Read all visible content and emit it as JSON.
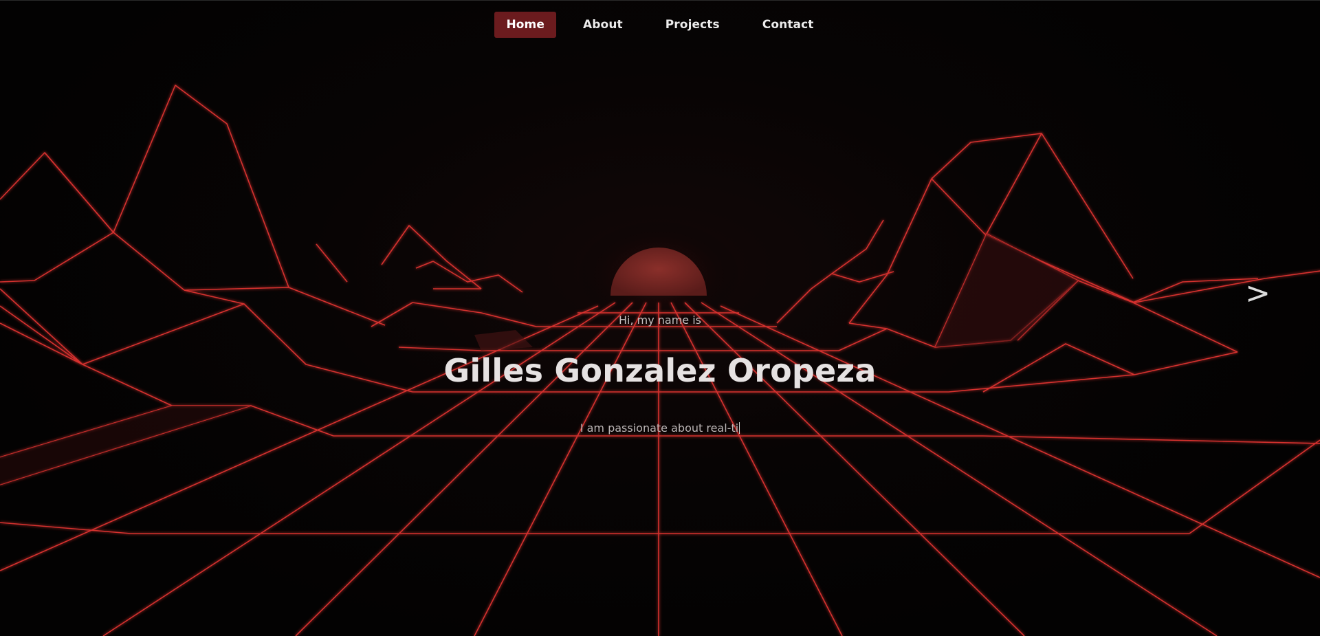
{
  "nav": {
    "items": [
      {
        "label": "Home",
        "active": true
      },
      {
        "label": "About",
        "active": false
      },
      {
        "label": "Projects",
        "active": false
      },
      {
        "label": "Contact",
        "active": false
      }
    ]
  },
  "hero": {
    "greeting": "Hi, my name is",
    "name": "Gilles Gonzalez Oropeza",
    "tagline": "I am passionate about real-ti"
  },
  "controls": {
    "next_label": ">"
  },
  "colors": {
    "background": "#050404",
    "accent": "#6b1b1e",
    "grid_line": "#e23a3a",
    "sun": "#7a2a26"
  }
}
